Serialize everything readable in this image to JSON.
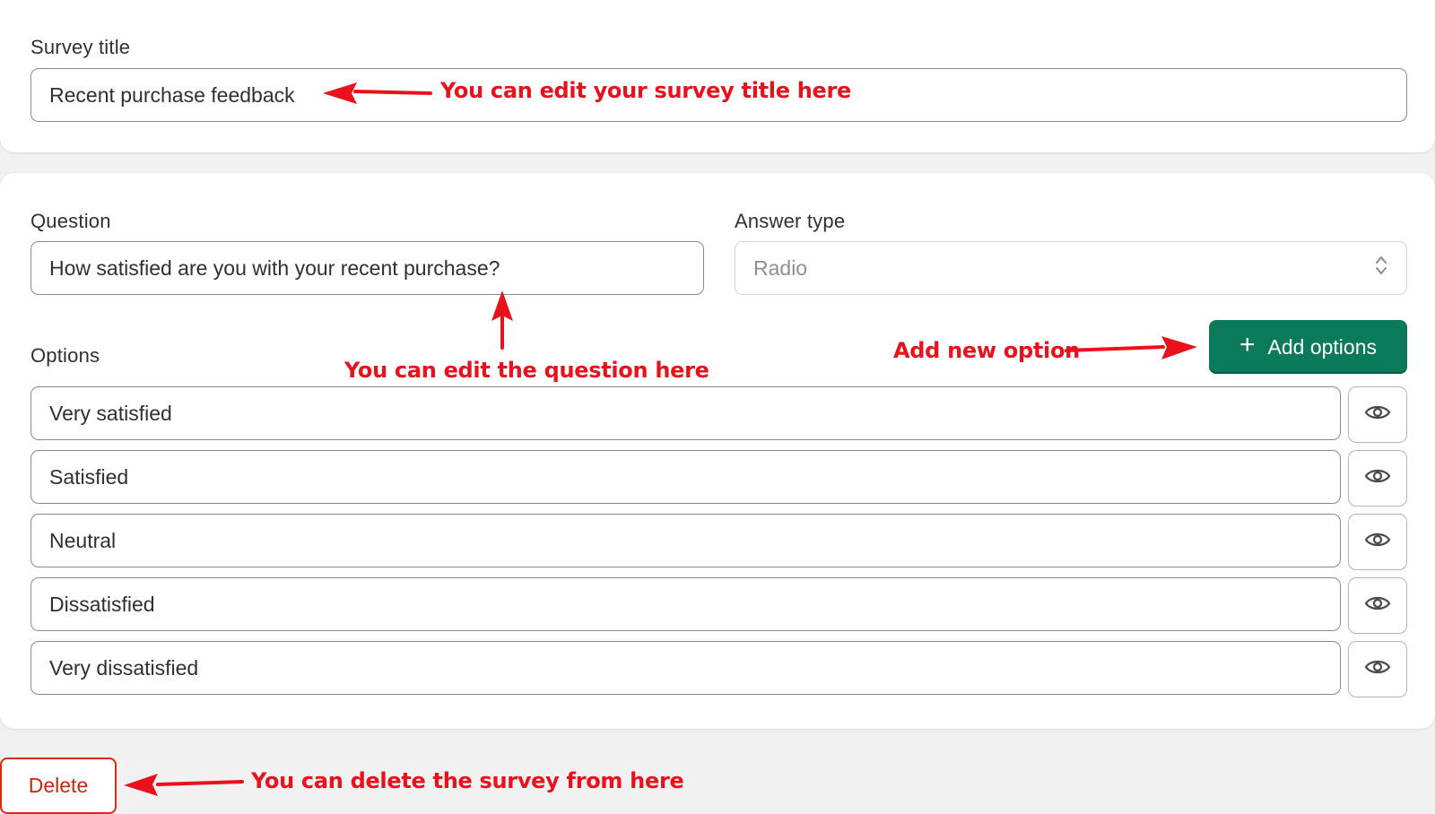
{
  "survey_title": {
    "label": "Survey title",
    "value": "Recent purchase feedback"
  },
  "question": {
    "label": "Question",
    "value": "How satisfied are you with your recent purchase?"
  },
  "answer_type": {
    "label": "Answer type",
    "value": "Radio"
  },
  "options": {
    "label": "Options",
    "add_button_label": "Add options",
    "items": [
      {
        "value": "Very satisfied"
      },
      {
        "value": "Satisfied"
      },
      {
        "value": "Neutral"
      },
      {
        "value": "Dissatisfied"
      },
      {
        "value": "Very dissatisfied"
      }
    ]
  },
  "delete_button_label": "Delete",
  "annotations": {
    "title_hint": "You can edit your survey title here",
    "question_hint": "You can edit the question here",
    "add_hint": "Add new option",
    "delete_hint": "You can delete the survey from here"
  },
  "icons": {
    "add": "plus-icon",
    "option_visibility": "eye-icon",
    "select": "chevron-up-down-icon"
  },
  "colors": {
    "primary_button": "#0a7a5a",
    "danger": "#d72c0d",
    "annotation": "#e8111c",
    "page_background": "#f1f1f1"
  }
}
